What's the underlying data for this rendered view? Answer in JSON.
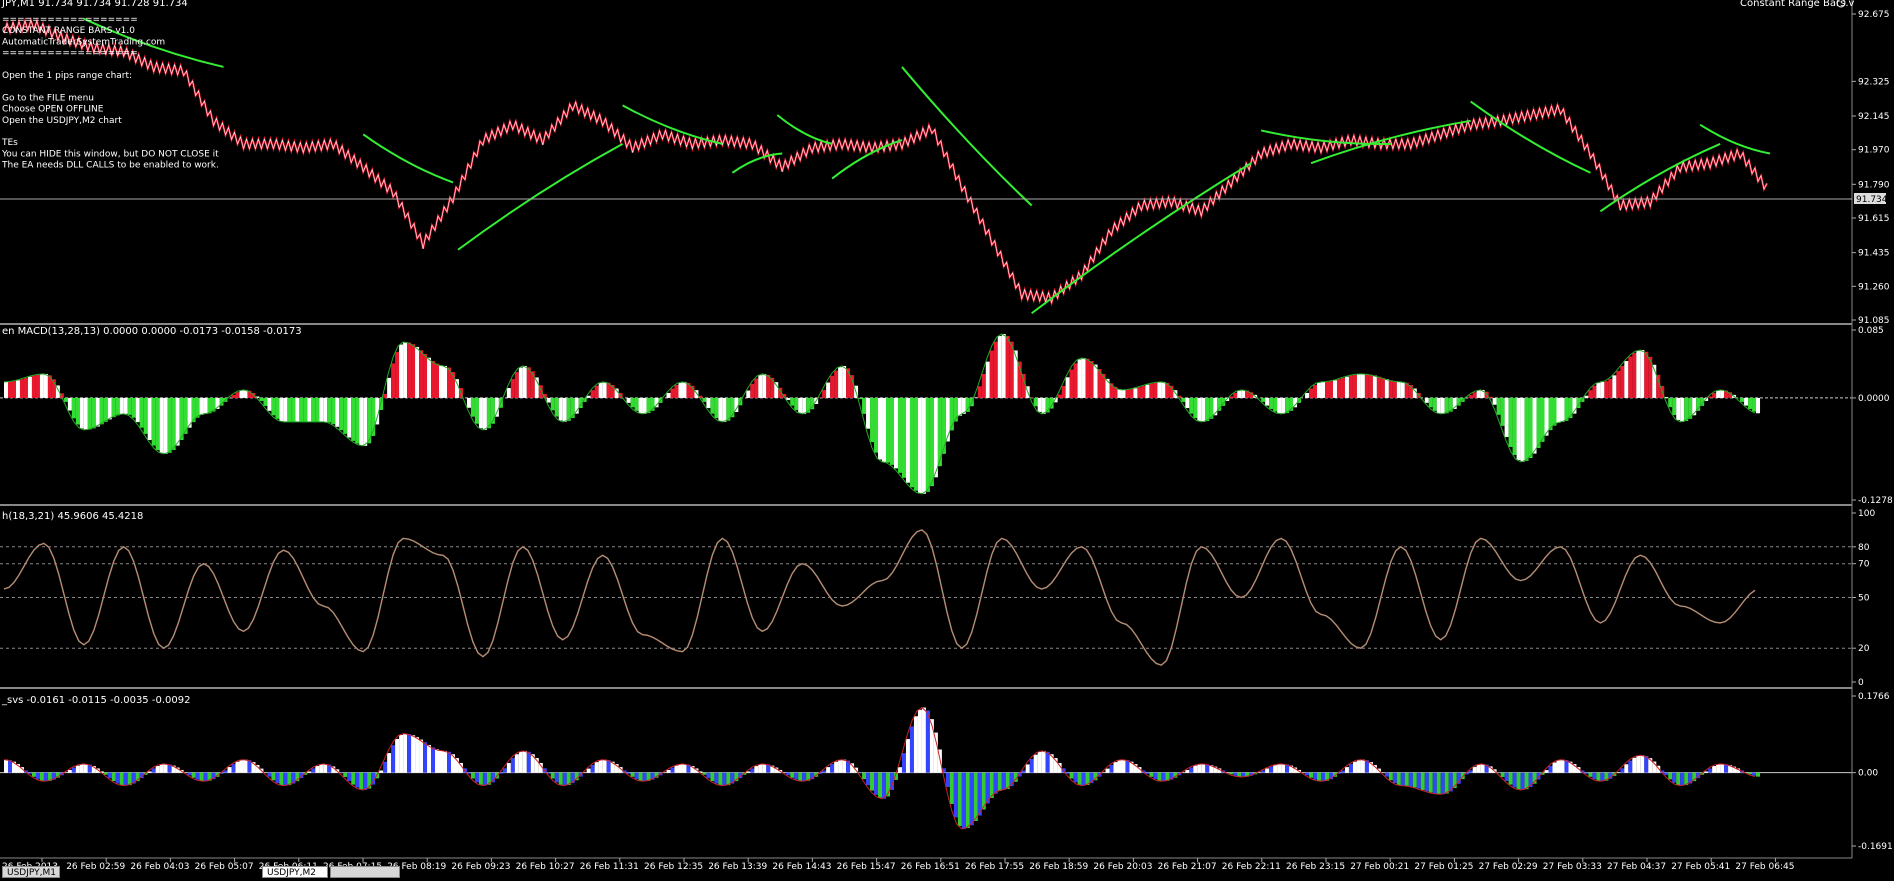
{
  "chart_title": "JPY,M1  91.734 91.734 91.728 91.734",
  "ea_name": "Constant Range Bars.v",
  "ea_notes": [
    "==================",
    "CONSTANT RANGE BARS v1.0",
    "AutomaticTraderSystemTrading.com",
    "==================",
    "",
    "Open the 1 pips range chart:",
    "",
    "Go to the FILE menu",
    "Choose OPEN OFFLINE",
    "Open the USDJPY,M2 chart",
    "",
    "TEs",
    "You can HIDE this window, but DO NOT CLOSE it",
    "The EA needs DLL CALLS to be enabled to work."
  ],
  "current_price": "91.734",
  "colors": {
    "bull": "#e8182f",
    "bear": "#33dd33",
    "hist_fill": "#ffffff",
    "ma_line": "#33ee33",
    "stoch": "#88aa88",
    "grid": "#888888"
  },
  "x_labels": [
    "26 Feb 2013",
    "26 Feb 02:59",
    "26 Feb 04:03",
    "26 Feb 05:07",
    "26 Feb 06:11",
    "26 Feb 07:15",
    "26 Feb 08:19",
    "26 Feb 09:23",
    "26 Feb 10:27",
    "26 Feb 11:31",
    "26 Feb 12:35",
    "26 Feb 13:39",
    "26 Feb 14:43",
    "26 Feb 15:47",
    "26 Feb 16:51",
    "26 Feb 17:55",
    "26 Feb 18:59",
    "26 Feb 20:03",
    "26 Feb 21:07",
    "26 Feb 22:11",
    "26 Feb 23:15",
    "27 Feb 00:21",
    "27 Feb 01:25",
    "27 Feb 02:29",
    "27 Feb 03:33",
    "27 Feb 04:37",
    "27 Feb 05:41",
    "27 Feb 06:45"
  ],
  "bottom_tabs": [
    "USDJPY,M1",
    "USDJPY,M2",
    ""
  ],
  "chart_data": [
    {
      "type": "line",
      "title": "JPY,M1  91.734 91.734 91.728 91.734",
      "ylim": [
        91.085,
        92.675
      ],
      "y_ticks": [
        "92.675",
        "92.325",
        "92.145",
        "91.970",
        "91.790",
        "91.615",
        "91.435",
        "91.260",
        "91.085"
      ],
      "y_tick_values": [
        92.675,
        92.325,
        92.145,
        91.97,
        91.79,
        91.615,
        91.435,
        91.26,
        91.085
      ],
      "series": [
        {
          "x": [
            0,
            30,
            60,
            90,
            120,
            150,
            180,
            210,
            240,
            270,
            300,
            330,
            360,
            390,
            420,
            450,
            480,
            510,
            540,
            570,
            600,
            630,
            660,
            690,
            720,
            750,
            780,
            810,
            840,
            870,
            900,
            930,
            960,
            990,
            1020,
            1050,
            1080,
            1110,
            1140,
            1170,
            1200,
            1230,
            1260,
            1290,
            1320,
            1350,
            1380,
            1410,
            1440,
            1470,
            1500,
            1530,
            1560,
            1590,
            1620,
            1650,
            1680,
            1710,
            1740,
            1770
          ],
          "y": [
            92.6,
            92.62,
            92.55,
            92.5,
            92.48,
            92.4,
            92.38,
            92.12,
            92.0,
            92.0,
            91.98,
            92.0,
            91.88,
            91.75,
            91.48,
            91.72,
            92.02,
            92.1,
            92.02,
            92.2,
            92.12,
            91.98,
            92.05,
            92.0,
            92.02,
            92.0,
            91.88,
            91.98,
            92.0,
            91.98,
            92.0,
            92.08,
            91.78,
            91.5,
            91.22,
            91.2,
            91.32,
            91.55,
            91.68,
            91.7,
            91.65,
            91.8,
            91.95,
            92.0,
            91.98,
            92.02,
            92.0,
            92.0,
            92.05,
            92.1,
            92.12,
            92.15,
            92.18,
            91.95,
            91.68,
            91.7,
            91.88,
            91.9,
            91.95,
            91.75
          ]
        }
      ]
    },
    {
      "type": "area",
      "title": "en MACD(13,28,13) 0.0000 0.0000 -0.0173 -0.0158 -0.0173",
      "ylim": [
        -0.1278,
        0.085
      ],
      "y_ticks": [
        "0.085",
        "0.0000",
        "-0.1278"
      ],
      "y_tick_values": [
        0.085,
        0.0,
        -0.1278
      ],
      "series": [
        {
          "name": "",
          "x": [
            0,
            40,
            80,
            120,
            160,
            200,
            240,
            280,
            320,
            360,
            400,
            440,
            480,
            520,
            560,
            600,
            640,
            680,
            720,
            760,
            800,
            840,
            880,
            920,
            960,
            1000,
            1040,
            1080,
            1120,
            1160,
            1200,
            1240,
            1280,
            1320,
            1360,
            1400,
            1440,
            1480,
            1520,
            1560,
            1600,
            1640,
            1680,
            1720,
            1760
          ],
          "y": [
            0.02,
            0.03,
            -0.04,
            -0.02,
            -0.07,
            -0.02,
            0.01,
            -0.03,
            -0.03,
            -0.06,
            0.07,
            0.04,
            -0.04,
            0.04,
            -0.03,
            0.02,
            -0.02,
            0.02,
            -0.03,
            0.03,
            -0.02,
            0.04,
            -0.08,
            -0.12,
            -0.02,
            0.08,
            -0.02,
            0.05,
            0.01,
            0.02,
            -0.03,
            0.01,
            -0.02,
            0.02,
            0.03,
            0.02,
            -0.02,
            0.01,
            -0.08,
            -0.03,
            0.02,
            0.06,
            -0.03,
            0.01,
            -0.02
          ]
        }
      ]
    },
    {
      "type": "line",
      "title": "h(18,3,21) 45.9606 45.4218",
      "ylim": [
        0,
        100
      ],
      "y_ticks": [
        "100",
        "80",
        "70",
        "50",
        "20",
        "0"
      ],
      "y_tick_values": [
        100,
        80,
        70,
        50,
        20,
        0
      ],
      "series": [
        {
          "name": "",
          "x": [
            0,
            40,
            80,
            120,
            160,
            200,
            240,
            280,
            320,
            360,
            400,
            440,
            480,
            520,
            560,
            600,
            640,
            680,
            720,
            760,
            800,
            840,
            880,
            920,
            960,
            1000,
            1040,
            1080,
            1120,
            1160,
            1200,
            1240,
            1280,
            1320,
            1360,
            1400,
            1440,
            1480,
            1520,
            1560,
            1600,
            1640,
            1680,
            1720,
            1760
          ],
          "y": [
            55,
            82,
            22,
            80,
            20,
            70,
            30,
            78,
            45,
            18,
            85,
            75,
            15,
            80,
            25,
            75,
            28,
            18,
            85,
            30,
            70,
            45,
            60,
            90,
            20,
            85,
            55,
            80,
            35,
            10,
            80,
            50,
            85,
            40,
            20,
            80,
            25,
            85,
            60,
            80,
            35,
            75,
            45,
            35,
            55
          ]
        }
      ]
    },
    {
      "type": "area",
      "title": "_svs -0.0161 -0.0115 -0.0035 -0.0092",
      "ylim": [
        -0.1691,
        0.1766
      ],
      "y_ticks": [
        "0.1766",
        "0.00",
        "-0.1691"
      ],
      "y_tick_values": [
        0.1766,
        0.0,
        -0.1691
      ],
      "series": [
        {
          "name": "",
          "x": [
            0,
            40,
            80,
            120,
            160,
            200,
            240,
            280,
            320,
            360,
            400,
            440,
            480,
            520,
            560,
            600,
            640,
            680,
            720,
            760,
            800,
            840,
            880,
            920,
            960,
            1000,
            1040,
            1080,
            1120,
            1160,
            1200,
            1240,
            1280,
            1320,
            1360,
            1400,
            1440,
            1480,
            1520,
            1560,
            1600,
            1640,
            1680,
            1720,
            1760
          ],
          "y": [
            0.03,
            -0.02,
            0.02,
            -0.03,
            0.02,
            -0.02,
            0.03,
            -0.03,
            0.02,
            -0.04,
            0.09,
            0.05,
            -0.03,
            0.05,
            -0.03,
            0.03,
            -0.02,
            0.02,
            -0.03,
            0.02,
            -0.02,
            0.03,
            -0.06,
            0.15,
            -0.13,
            -0.04,
            0.05,
            -0.03,
            0.03,
            -0.02,
            0.02,
            -0.01,
            0.02,
            -0.02,
            0.03,
            -0.03,
            -0.05,
            0.02,
            -0.04,
            0.03,
            -0.02,
            0.04,
            -0.03,
            0.02,
            -0.01
          ]
        }
      ]
    }
  ]
}
